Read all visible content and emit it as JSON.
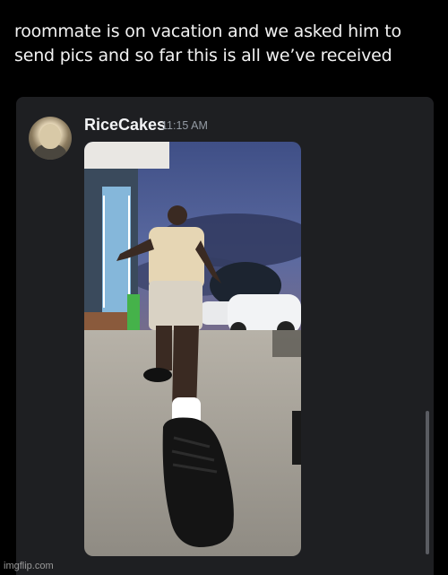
{
  "caption": {
    "line1": "roommate is on vacation and we asked him to",
    "line2": "send pics and so far this is all we’ve received"
  },
  "message": {
    "username": "RiceCakes",
    "timestamp": "11:15 AM",
    "avatar_icon": "user-avatar"
  },
  "attachment": {
    "icon": "photo-attachment"
  },
  "watermark": "imgflip.com"
}
